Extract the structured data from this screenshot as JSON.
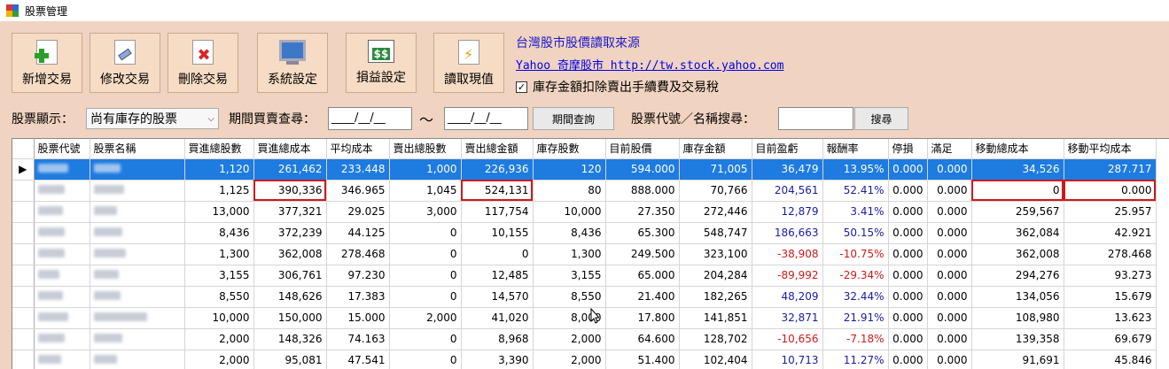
{
  "window": {
    "title": "股票管理"
  },
  "toolbar": [
    {
      "name": "add-trade-button",
      "label": "新增交易",
      "icon": "add-document-icon"
    },
    {
      "name": "edit-trade-button",
      "label": "修改交易",
      "icon": "edit-document-icon"
    },
    {
      "name": "delete-trade-button",
      "label": "刪除交易",
      "icon": "delete-document-icon"
    },
    {
      "name": "system-settings-button",
      "label": "系統設定",
      "icon": "monitor-icon"
    },
    {
      "name": "profit-loss-settings-button",
      "label": "損益設定",
      "icon": "money-icon"
    },
    {
      "name": "read-current-price-button",
      "label": "讀取現值",
      "icon": "lightning-document-icon"
    }
  ],
  "source": {
    "title": "台灣股市股價讀取來源",
    "link": "Yahoo 奇摩股市 http://tw.stock.yahoo.com",
    "checkbox_label": "庫存金額扣除賣出手續費及交易稅",
    "checkbox_checked": "✓"
  },
  "filters": {
    "display_label": "股票顯示：",
    "display_value": "尚有庫存的股票",
    "period_label": "期間買賣查尋：",
    "date_from": "____/__/__",
    "tilde": "～",
    "date_to": "____/__/__",
    "period_button": "期間查詢",
    "search_label": "股票代號／名稱搜尋：",
    "search_value": "",
    "search_button": "搜尋"
  },
  "grid": {
    "columns": [
      "股票代號",
      "股票名稱",
      "買進總股數",
      "買進總成本",
      "平均成本",
      "賣出總股數",
      "賣出總金額",
      "庫存股數",
      "目前股價",
      "庫存金額",
      "目前盈虧",
      "報酬率",
      "停損",
      "滿足",
      "移動總成本",
      "移動平均成本"
    ],
    "rows": [
      [
        "",
        "",
        "1,120",
        "261,462",
        "233.448",
        "1,000",
        "226,936",
        "120",
        "594.000",
        "71,005",
        "36,479",
        "13.95%",
        "0.000",
        "0.000",
        "34,526",
        "287.717"
      ],
      [
        "",
        "",
        "1,125",
        "390,336",
        "346.965",
        "1,045",
        "524,131",
        "80",
        "888.000",
        "70,766",
        "204,561",
        "52.41%",
        "0.000",
        "0.000",
        "0",
        "0.000"
      ],
      [
        "",
        "",
        "13,000",
        "377,321",
        "29.025",
        "3,000",
        "117,754",
        "10,000",
        "27.350",
        "272,446",
        "12,879",
        "3.41%",
        "0.000",
        "0.000",
        "259,567",
        "25.957"
      ],
      [
        "",
        "",
        "8,436",
        "372,239",
        "44.125",
        "0",
        "10,155",
        "8,436",
        "65.300",
        "548,747",
        "186,663",
        "50.15%",
        "0.000",
        "0.000",
        "362,084",
        "42.921"
      ],
      [
        "",
        "",
        "1,300",
        "362,008",
        "278.468",
        "0",
        "0",
        "1,300",
        "249.500",
        "323,100",
        "-38,908",
        "-10.75%",
        "0.000",
        "0.000",
        "362,008",
        "278.468"
      ],
      [
        "",
        "",
        "3,155",
        "306,761",
        "97.230",
        "0",
        "12,485",
        "3,155",
        "65.000",
        "204,284",
        "-89,992",
        "-29.34%",
        "0.000",
        "0.000",
        "294,276",
        "93.273"
      ],
      [
        "",
        "",
        "8,550",
        "148,626",
        "17.383",
        "0",
        "14,570",
        "8,550",
        "21.400",
        "182,265",
        "48,209",
        "32.44%",
        "0.000",
        "0.000",
        "134,056",
        "15.679"
      ],
      [
        "",
        "",
        "10,000",
        "150,000",
        "15.000",
        "2,000",
        "41,020",
        "8,000",
        "17.800",
        "141,851",
        "32,871",
        "21.91%",
        "0.000",
        "0.000",
        "108,980",
        "13.623"
      ],
      [
        "",
        "",
        "2,000",
        "148,326",
        "74.163",
        "0",
        "8,968",
        "2,000",
        "64.600",
        "128,702",
        "-10,656",
        "-7.18%",
        "0.000",
        "0.000",
        "139,358",
        "69.679"
      ],
      [
        "",
        "",
        "2,000",
        "95,081",
        "47.541",
        "0",
        "3,390",
        "2,000",
        "51.400",
        "102,404",
        "10,713",
        "11.27%",
        "0.000",
        "0.000",
        "91,691",
        "45.846"
      ]
    ],
    "selected_row_marker": "▶"
  },
  "colors": {
    "background": "#f0d3c0",
    "selection": "#1e7be0",
    "positive": "#1a1aa8",
    "negative": "#d01818",
    "highlight_box": "#d01818"
  }
}
